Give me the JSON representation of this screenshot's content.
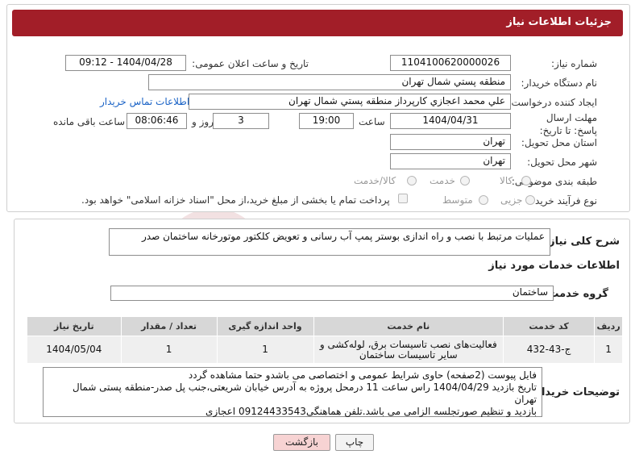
{
  "header": {
    "title": "جزئیات اطلاعات نیاز"
  },
  "fields": {
    "need_number_label": "شماره نیاز:",
    "need_number": "1104100620000026",
    "announce_label": "تاریخ و ساعت اعلان عمومی:",
    "announce_value": "1404/04/28 - 09:12",
    "buyer_org_label": "نام دستگاه خریدار:",
    "buyer_org": "منطقه پستي شمال تهران",
    "requester_label": "ایجاد کننده درخواست:",
    "requester": "علي محمد اعجازي كارپرداز منطقه پستي شمال تهران",
    "contact_link": "اطلاعات تماس خریدار",
    "deadline_label": "مهلت ارسال پاسخ: تا تاریخ:",
    "deadline_date": "1404/04/31",
    "time_label": "ساعت",
    "deadline_time": "19:00",
    "days_value": "3",
    "days_label": "روز و",
    "remaining_time": "08:06:46",
    "remaining_label": "ساعت باقی مانده",
    "province_label": "استان محل تحویل:",
    "province": "تهران",
    "city_label": "شهر محل تحویل:",
    "city": "تهران",
    "category_label": "طبقه بندی موضوعی:",
    "category_options": [
      "کالا",
      "خدمت",
      "کالا/خدمت"
    ],
    "purchase_type_label": "نوع فرآیند خرید :",
    "purchase_options": [
      "جزیی",
      "متوسط"
    ],
    "payment_note": "پرداخت تمام یا بخشی از مبلغ خرید،از محل \"اسناد خزانه اسلامی\" خواهد بود."
  },
  "summary": {
    "label": "شرح کلی نیاز:",
    "text": "عملیات مرتبط با نصب و راه اندازی بوستر پمپ آب رسانی و تعویض کلکتور موتورخانه ساختمان صدر"
  },
  "services": {
    "section_title": "اطلاعات خدمات مورد نیاز",
    "group_label": "گروه خدمت:",
    "group_value": "ساختمان",
    "columns": [
      "ردیف",
      "کد خدمت",
      "نام خدمت",
      "واحد اندازه گیری",
      "تعداد / مقدار",
      "تاریخ نیاز"
    ],
    "rows": [
      [
        "1",
        "ج-43-432",
        "فعالیت‌های نصب تاسیسات برق، لوله‌کشی و سایر تاسیسات ساختمان",
        "1",
        "1",
        "1404/05/04"
      ]
    ]
  },
  "notes": {
    "label": "توضیحات خریدار:",
    "lines": [
      "فایل پیوست (2صفحه) حاوی شرایط عمومی و اختصاصی می باشدو حتما مشاهده گردد",
      "تاریخ بازدید 1404/04/29 راس ساعت 11 درمحل پروژه به آدرس خیابان شریعتی،جنب پل صدر-منطقه پستی شمال تهران",
      "بازدید و تنظیم صورتجلسه الزامی می باشد.تلفن هماهنگی09124433543 اعجازی"
    ]
  },
  "buttons": {
    "print": "چاپ",
    "back": "بازگشت"
  },
  "colors": {
    "header": "#a21e28",
    "link": "#1a63c6",
    "back_button": "#f7d3d3",
    "print_button": "#f3f3f3"
  }
}
